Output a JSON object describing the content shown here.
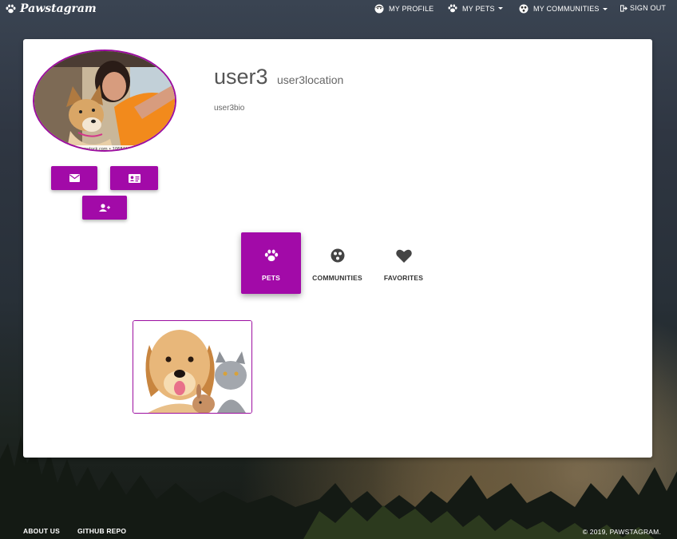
{
  "brand": {
    "name": "Pawstagram",
    "icon": "paw-icon"
  },
  "nav": {
    "my_profile": "MY PROFILE",
    "my_pets": "MY PETS",
    "my_communities": "MY COMMUNITIES",
    "sign_out": "SIGN OUT"
  },
  "profile": {
    "username": "user3",
    "location": "user3location",
    "bio": "user3bio",
    "avatar_watermark": "dreamstock.com • 10684118",
    "actions": [
      {
        "name": "message",
        "icon": "envelope-icon"
      },
      {
        "name": "contact-card",
        "icon": "id-card-icon"
      },
      {
        "name": "follow",
        "icon": "user-plus-icon"
      }
    ]
  },
  "tabs": [
    {
      "label": "PETS",
      "icon": "paw-icon",
      "active": true
    },
    {
      "label": "COMMUNITIES",
      "icon": "group-icon",
      "active": false
    },
    {
      "label": "FAVORITES",
      "icon": "heart-icon",
      "active": false
    }
  ],
  "footer": {
    "about": "ABOUT US",
    "github": "GITHUB REPO",
    "copyright": "© 2019, PAWSTAGRAM."
  },
  "colors": {
    "accent": "#a20aa8",
    "card": "#ffffff",
    "text": "#555555"
  }
}
